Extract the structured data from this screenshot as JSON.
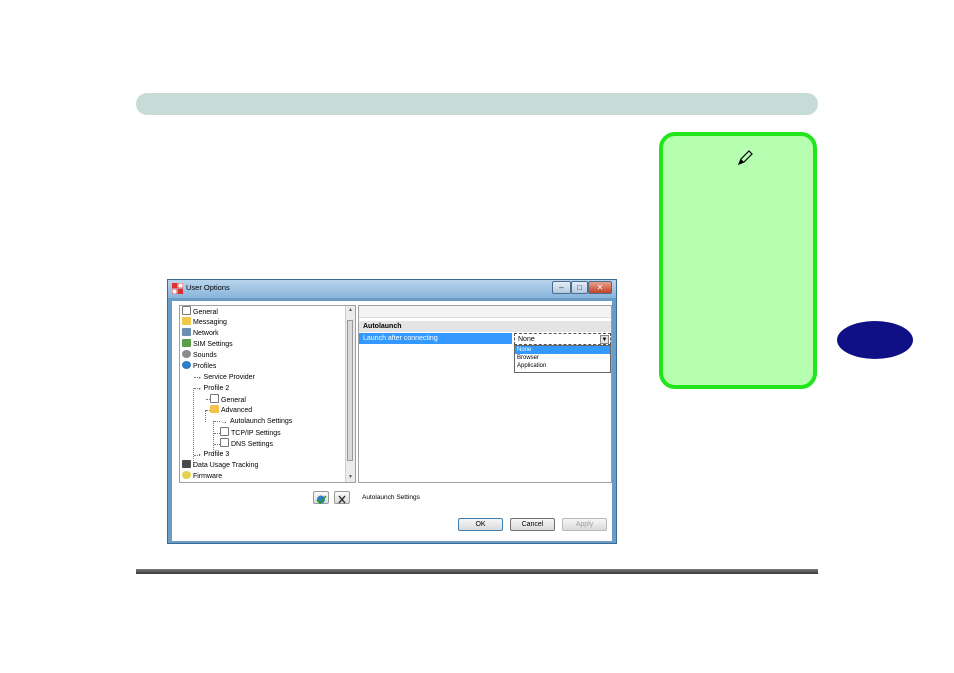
{
  "colors": {
    "header_bar": "#c7dcd6",
    "note_fill": "#b7ffb0",
    "note_border": "#22e51c",
    "tab_oval": "#0f0f86",
    "selection": "#3399ff"
  },
  "window": {
    "title": "User Options",
    "minimize_icon": "minimize-icon",
    "maximize_icon": "maximize-icon",
    "close_icon": "close-icon"
  },
  "tree": {
    "items": [
      {
        "label": "General",
        "icon": "page-icon"
      },
      {
        "label": "Messaging",
        "icon": "envelope-icon"
      },
      {
        "label": "Network",
        "icon": "network-icon"
      },
      {
        "label": "SIM Settings",
        "icon": "sim-card-icon"
      },
      {
        "label": "Sounds",
        "icon": "speaker-icon"
      },
      {
        "label": "Profiles",
        "icon": "globe-icon"
      },
      {
        "label": "Service Provider",
        "icon": "antenna-icon"
      },
      {
        "label": "Profile 2",
        "icon": "antenna-icon"
      },
      {
        "label": "General",
        "icon": "page-icon"
      },
      {
        "label": "Advanced",
        "icon": "folder-open-icon"
      },
      {
        "label": "Autolaunch Settings",
        "icon": "arrow-right-icon"
      },
      {
        "label": "TCP/IP Settings",
        "icon": "page-icon"
      },
      {
        "label": "DNS Settings",
        "icon": "page-icon"
      },
      {
        "label": "Profile 3",
        "icon": "antenna-icon"
      },
      {
        "label": "Data Usage Tracking",
        "icon": "meter-icon"
      },
      {
        "label": "Firmware",
        "icon": "chip-icon"
      }
    ]
  },
  "panel": {
    "section": "Autolaunch",
    "property_label": "Launch after connecting",
    "select_value": "None",
    "options": [
      "None",
      "Browser",
      "Application"
    ],
    "selected_option": "None"
  },
  "status": {
    "label": "Autolaunch Settings",
    "apply_icon": "apply-globe-icon",
    "discard_icon": "discard-x-icon"
  },
  "buttons": {
    "ok": "OK",
    "cancel": "Cancel",
    "apply": "Apply"
  }
}
